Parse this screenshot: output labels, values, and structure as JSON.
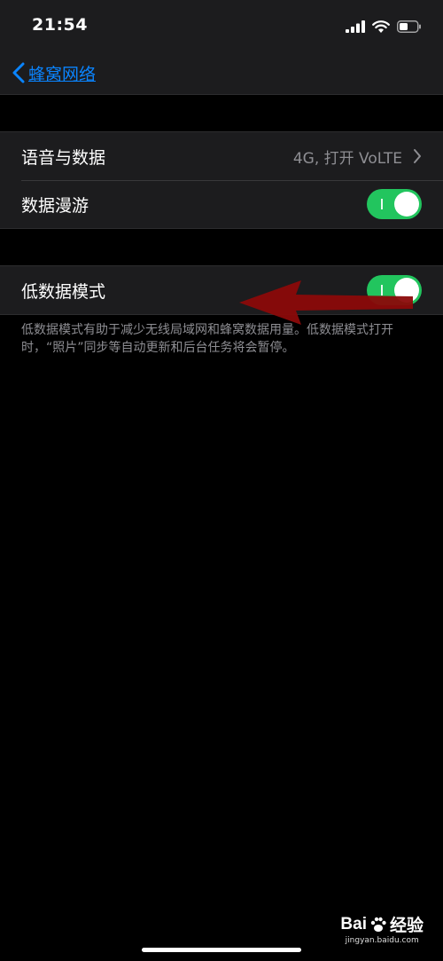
{
  "status_bar": {
    "time": "21:54",
    "icons": [
      "cellular-signal-icon",
      "wifi-icon",
      "battery-icon"
    ]
  },
  "nav": {
    "back_label": "蜂窝网络",
    "accent_color": "#0a84ff"
  },
  "group1": {
    "rows": [
      {
        "label": "语音与数据",
        "value": "4G, 打开 VoLTE",
        "type": "disclosure"
      },
      {
        "label": "数据漫游",
        "toggle_on": true,
        "type": "toggle"
      }
    ]
  },
  "group2": {
    "rows": [
      {
        "label": "低数据模式",
        "toggle_on": true,
        "type": "toggle"
      }
    ],
    "footnote": "低数据模式有助于减少无线局域网和蜂窝数据用量。低数据模式打开时，“照片”同步等自动更新和后台任务将会暂停。"
  },
  "colors": {
    "toggle_on": "#22c55e",
    "annotation_arrow": "#8b0a0a"
  },
  "watermark": {
    "brand_left": "Bai",
    "brand_right": "经验",
    "url": "jingyan.baidu.com"
  }
}
